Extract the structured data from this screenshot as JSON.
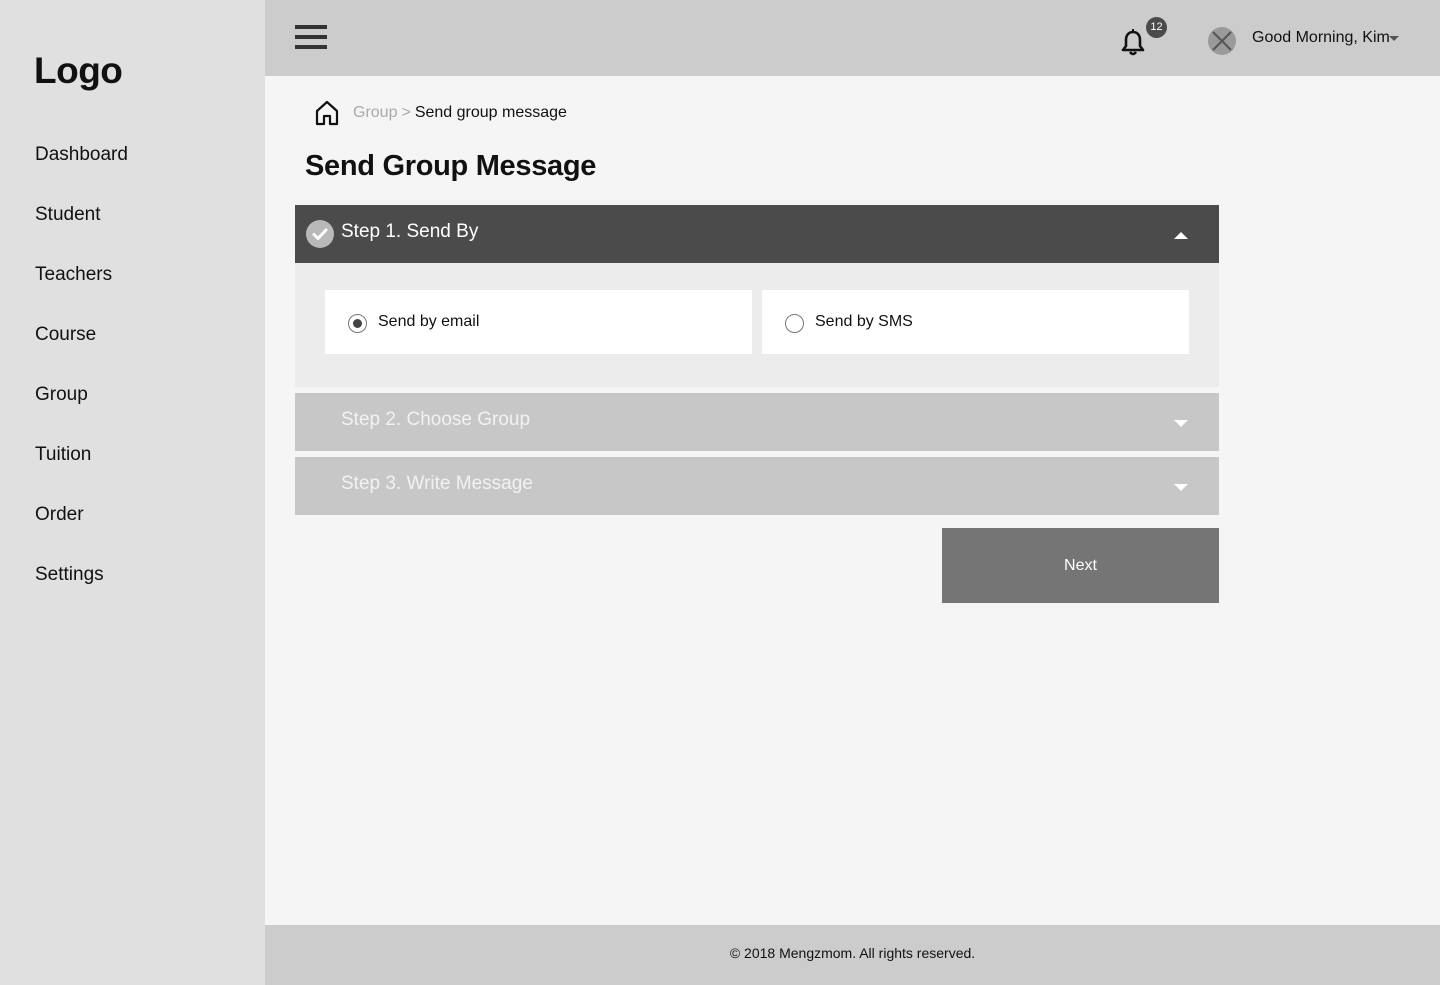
{
  "sidebar": {
    "logo": "Logo",
    "items": [
      {
        "label": "Dashboard"
      },
      {
        "label": "Student"
      },
      {
        "label": "Teachers"
      },
      {
        "label": "Course"
      },
      {
        "label": "Group"
      },
      {
        "label": "Tuition"
      },
      {
        "label": "Order"
      },
      {
        "label": "Settings"
      }
    ]
  },
  "header": {
    "notification_count": "12",
    "greeting": "Good Morning, Kim",
    "icons": {
      "menu": "hamburger-menu-icon",
      "notifications": "bell-icon",
      "avatar": "avatar-placeholder-icon",
      "user_menu": "chevron-down-icon"
    }
  },
  "breadcrumb": {
    "home_icon": "home-icon",
    "parent": "Group",
    "separator": ">",
    "current": "Send group message"
  },
  "page": {
    "title": "Send Group Message"
  },
  "steps": [
    {
      "label": "Step 1. Send By",
      "expanded": true,
      "completed": true,
      "options": [
        {
          "label": "Send by email",
          "selected": true
        },
        {
          "label": "Send by SMS",
          "selected": false
        }
      ]
    },
    {
      "label": "Step 2. Choose Group",
      "expanded": false
    },
    {
      "label": "Step 3. Write Message",
      "expanded": false
    }
  ],
  "actions": {
    "next_label": "Next"
  },
  "footer": {
    "text": "© 2018 Mengzmom. All rights reserved."
  },
  "colors": {
    "sidebar_bg": "#e0e0e0",
    "topbar_bg": "#cccccc",
    "content_bg": "#f5f5f5",
    "active_step_bg": "#4b4b4b",
    "inactive_step_bg": "#c7c7c7",
    "next_button_bg": "#757575"
  }
}
